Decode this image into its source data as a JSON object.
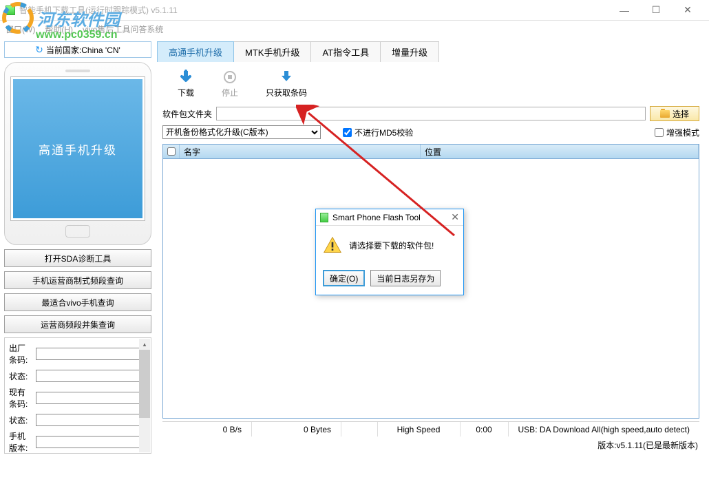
{
  "window": {
    "title": "智能手机下载工具(运行时跟踪模式)  v5.1.11",
    "min": "—",
    "max": "☐",
    "close": "✕"
  },
  "menu": {
    "window": "窗口(W)",
    "help": "帮助(H)",
    "vivo": "vivo售后工具问答系统"
  },
  "watermark": {
    "text": "河东软件园",
    "url": "www.pc0359.cn"
  },
  "sidebar": {
    "country_label": "当前国家:China 'CN'",
    "phone_text": "高通手机升级",
    "buttons": [
      "打开SDA诊断工具",
      "手机运营商制式频段查询",
      "最适合vivo手机查询",
      "运营商频段并集查询"
    ],
    "info_rows": [
      {
        "label": "出厂条码:",
        "value": ""
      },
      {
        "label": "状态:",
        "value": ""
      },
      {
        "label": "现有条码:",
        "value": ""
      },
      {
        "label": "状态:",
        "value": ""
      },
      {
        "label": "手机版本:",
        "value": ""
      }
    ]
  },
  "tabs": [
    "高通手机升级",
    "MTK手机升级",
    "AT指令工具",
    "增量升级"
  ],
  "toolbar": {
    "download": "下载",
    "stop": "停止",
    "barcode": "只获取条码"
  },
  "form": {
    "folder_label": "软件包文件夹",
    "folder_value": "",
    "select_btn": "选择",
    "mode_value": "开机备份格式化升级(C版本)",
    "md5_label": "不进行MD5校验",
    "enhance_label": "增强模式"
  },
  "table": {
    "col_name": "名字",
    "col_pos": "位置"
  },
  "dialog": {
    "title": "Smart Phone Flash Tool",
    "msg": "请选择要下载的软件包!",
    "ok": "确定(O)",
    "save": "当前日志另存为"
  },
  "status": {
    "speed": "0 B/s",
    "bytes": "0 Bytes",
    "mode": "High Speed",
    "time": "0:00",
    "usb": "USB: DA Download All(high speed,auto detect)"
  },
  "version": "版本:v5.1.11(已是最新版本)"
}
